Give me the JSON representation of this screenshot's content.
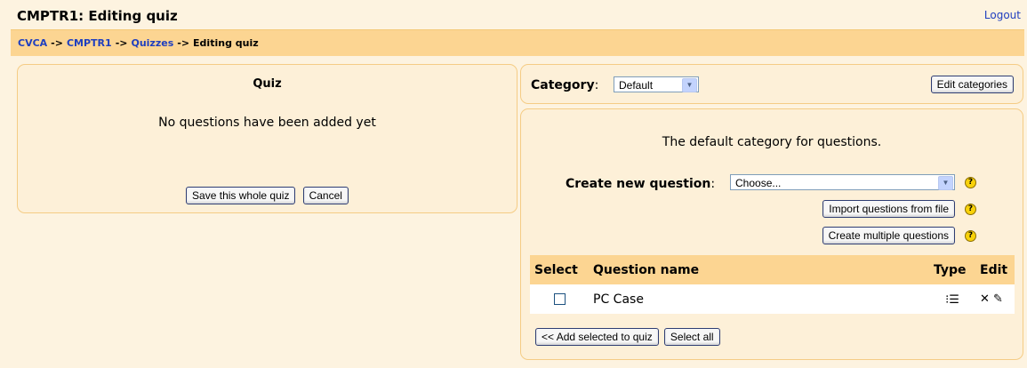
{
  "header": {
    "title": "CMPTR1: Editing quiz",
    "logout": "Logout"
  },
  "breadcrumb": {
    "items": [
      "CVCA",
      "CMPTR1",
      "Quizzes"
    ],
    "current": "Editing quiz",
    "separator": "->"
  },
  "quiz": {
    "title": "Quiz",
    "empty_message": "No questions have been added yet",
    "save_label": "Save this whole quiz",
    "cancel_label": "Cancel"
  },
  "category": {
    "label": "Category",
    "selected": "Default",
    "edit_label": "Edit categories"
  },
  "question_bank": {
    "description": "The default category for questions.",
    "create_label": "Create new question",
    "create_selected": "Choose...",
    "import_label": "Import questions from file",
    "multiple_label": "Create multiple questions",
    "columns": {
      "select": "Select",
      "name": "Question name",
      "type": "Type",
      "edit": "Edit"
    },
    "rows": [
      {
        "name": "PC Case",
        "type_icon": "multichoice-icon",
        "checked": false
      }
    ],
    "add_selected_label": "<< Add selected to quiz",
    "select_all_label": "Select all"
  },
  "colors": {
    "page_bg": "#fdf3e0",
    "nav_bg": "#fcd592",
    "link": "#1f3fbf",
    "border": "#f5cc85"
  }
}
